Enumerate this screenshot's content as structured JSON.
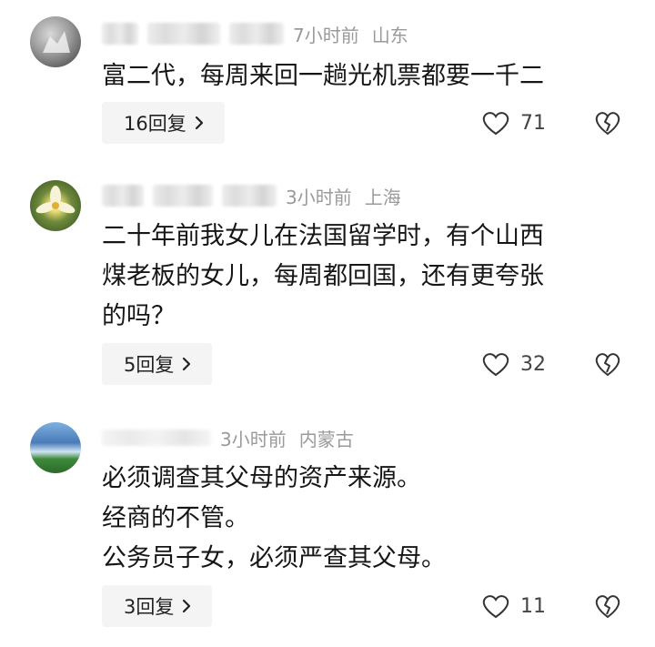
{
  "comments": [
    {
      "time": "7小时前",
      "location": "山东",
      "text": "富二代，每周来回一趟光机票都要一千二",
      "replies": "16回复",
      "likes": "71"
    },
    {
      "time": "3小时前",
      "location": "上海",
      "text": "二十年前我女儿在法国留学时，有个山西\n煤老板的女儿，每周都回国，还有更夸张\n的吗？",
      "replies": "5回复",
      "likes": "32"
    },
    {
      "time": "3小时前",
      "location": "内蒙古",
      "text": "必须调查其父母的资产来源。\n经商的不管。\n公务员子女，必须严查其父母。",
      "replies": "3回复",
      "likes": "11"
    }
  ],
  "icons": {
    "like": "heart-outline-icon",
    "dislike": "broken-heart-icon",
    "chevron": "chevron-right-icon"
  }
}
